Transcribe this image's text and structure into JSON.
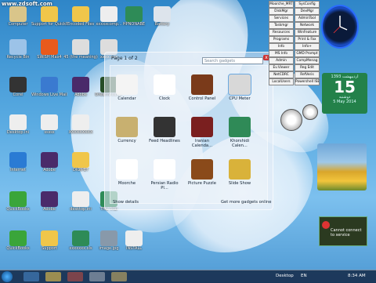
{
  "watermark": "www.zdsoft.com",
  "desktop_icons": [
    {
      "label": "Computer",
      "icon": "computer-icon",
      "color": "#d9c58a"
    },
    {
      "label": "Support for QuickBooks",
      "icon": "folder-icon",
      "color": "#f0c64a"
    },
    {
      "label": "Encoded Files",
      "icon": "folder-icon",
      "color": "#f0c64a"
    },
    {
      "label": "xxxxxcomp...",
      "icon": "file-icon",
      "color": "#eeeeee"
    },
    {
      "label": "HPNONABE\nW8.xlsx",
      "icon": "excel-icon",
      "color": "#2e8b57"
    },
    {
      "label": "Battery\npercentage",
      "icon": "file-icon",
      "color": "#dde4ec"
    },
    {
      "label": "Recycle Bin",
      "icon": "recycle-bin-icon",
      "color": "#9cc3e8"
    },
    {
      "label": "SWiSH Max4",
      "icon": "swish-icon",
      "color": "#e85a1c"
    },
    {
      "label": "45 (the meaning)",
      "icon": "file-icon",
      "color": "#dddddd"
    },
    {
      "label": "xxxx.exe",
      "icon": "file-icon",
      "color": "#dddddd"
    },
    {
      "label": "Corel\nVideoStudio",
      "icon": "corel-icon",
      "color": "#333333"
    },
    {
      "label": "Windows Live Mail",
      "icon": "mail-icon",
      "color": "#3a7ad0"
    },
    {
      "label": "Adobe\nPremiere Pro",
      "icon": "premiere-icon",
      "color": "#4a2a6a"
    },
    {
      "label": "Dreamweaver",
      "icon": "dreamweaver-icon",
      "color": "#264d26"
    },
    {
      "label": "Desktop.ini",
      "icon": "file-icon",
      "color": "#eeeeee"
    },
    {
      "label": "sssss\n(xxxx)",
      "icon": "file-icon",
      "color": "#eeeeee"
    },
    {
      "label": "XXXXXXXXX",
      "icon": "file-icon",
      "color": "#eeeeee"
    },
    {
      "label": "Internet\nExplorer",
      "icon": "ie-icon",
      "color": "#2a7bd4"
    },
    {
      "label": "Adobe\nPremiere Pro",
      "icon": "premiere-icon",
      "color": "#4a2a6a"
    },
    {
      "label": "DIGIPET\nMICROLINK",
      "icon": "folder-icon",
      "color": "#f0c64a"
    },
    {
      "label": "QuickBooks\nPremier - Ac...",
      "icon": "quickbooks-icon",
      "color": "#3aa53a"
    },
    {
      "label": "Adobe\nPremiere Pro",
      "icon": "premiere-icon",
      "color": "#4a2a6a"
    },
    {
      "label": "desktop.ini",
      "icon": "file-icon",
      "color": "#eeeeee"
    },
    {
      "label": "This Trial\nDocument.xlsx",
      "icon": "excel-icon",
      "color": "#2e8b57"
    },
    {
      "label": "QuickBooks\nPremier Ed...",
      "icon": "quickbooks-icon",
      "color": "#3aa53a"
    },
    {
      "label": "Support",
      "icon": "folder-icon",
      "color": "#f0c64a"
    },
    {
      "label": "xxxxxxx.xls",
      "icon": "excel-icon",
      "color": "#2e8b57"
    },
    {
      "label": "image.jpg",
      "icon": "image-icon",
      "color": "#8899aa"
    },
    {
      "label": "INSTALL",
      "icon": "file-icon",
      "color": "#eeeeee"
    }
  ],
  "gadget_gallery": {
    "page_label": "Page 1 of 2",
    "search_placeholder": "Search gadgets",
    "close": "x",
    "items": [
      {
        "label": "Calendar",
        "icon": "calendar-icon",
        "color": "#f4f4f4"
      },
      {
        "label": "Clock",
        "icon": "clock-icon",
        "color": "#ffffff"
      },
      {
        "label": "Control Panel",
        "icon": "control-panel-icon",
        "color": "#7a3a1a"
      },
      {
        "label": "CPU Meter",
        "icon": "cpu-meter-icon",
        "color": "#d8d8d8"
      },
      {
        "label": "Currency",
        "icon": "currency-icon",
        "color": "#c8b070"
      },
      {
        "label": "Feed Headlines",
        "icon": "feed-icon",
        "color": "#333333"
      },
      {
        "label": "Iranian Calenda...",
        "icon": "iranian-calendar-icon",
        "color": "#7a1f1f"
      },
      {
        "label": "Khorshidi Calen...",
        "icon": "khorshidi-calendar-icon",
        "color": "#2f8a57"
      },
      {
        "label": "Moorche",
        "icon": "moorche-icon",
        "color": "#ffffff"
      },
      {
        "label": "Persian Radio Pl...",
        "icon": "radio-icon",
        "color": "#ffffff"
      },
      {
        "label": "Picture Puzzle",
        "icon": "puzzle-icon",
        "color": "#8a4a1a"
      },
      {
        "label": "Slide Show",
        "icon": "slideshow-icon",
        "color": "#d9b23a"
      }
    ],
    "show_details": "Show details",
    "get_more": "Get more gadgets online"
  },
  "shortcut_buttons": [
    "Moorche_MRT",
    "SysConfig",
    "DiskMgr",
    "DevMgr",
    "Services",
    "AdminTool",
    "Taskmgr",
    "Network",
    "Resources",
    "WinFeature",
    "Programs",
    "Print & Fax",
    "Info",
    "Info+",
    "MS Info",
    "GMD Prompt",
    "Admin",
    "CompMenag",
    "Ev.Viewer",
    "Reg Edit",
    "NetCDRC",
    "RefVeris",
    "LocalUsers",
    "Powershell ISE"
  ],
  "clock_gadget": {
    "icon": "analog-clock-icon"
  },
  "calendar_gadget": {
    "top": "1393 اردیبهشت",
    "day": "15",
    "weekday": "دوشنبه",
    "bottom": "5 May 2014"
  },
  "network_gadget": {
    "text": "Cannot connect to service"
  },
  "taskbar": {
    "desktop_label": "Desktop",
    "lang": "EN",
    "time": "8:34 AM"
  }
}
